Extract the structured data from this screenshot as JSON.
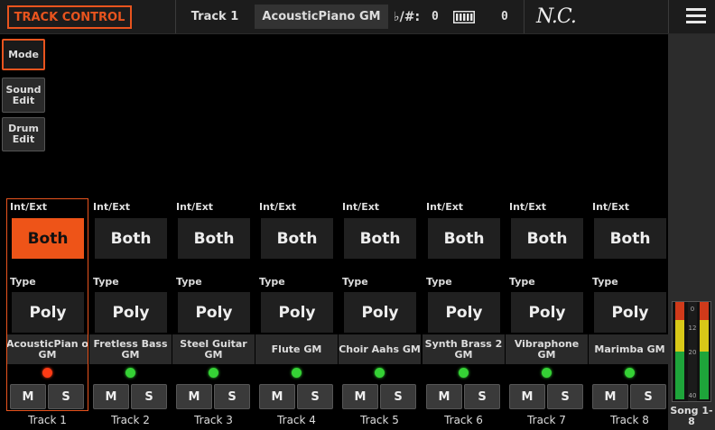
{
  "header": {
    "title": "TRACK CONTROL",
    "track": "Track 1",
    "sound": "AcousticPiano GM",
    "key_label": "♭/#:",
    "key_value": "0",
    "octave_value": "0",
    "chord": "N.C."
  },
  "sidebar": {
    "buttons": [
      {
        "label": "Mode",
        "active": true
      },
      {
        "label": "Sound Edit",
        "active": false
      },
      {
        "label": "Drum Edit",
        "active": false
      }
    ],
    "meter_scale": [
      "0",
      "12",
      "20",
      "40"
    ],
    "song_label": "Song 1-8"
  },
  "labels": {
    "int_ext": "Int/Ext",
    "type": "Type",
    "mute": "M",
    "solo": "S"
  },
  "tracks": [
    {
      "int_ext": "Both",
      "type": "Poly",
      "sound": "AcousticPian o GM",
      "name": "Track 1",
      "led": "red",
      "selected": true
    },
    {
      "int_ext": "Both",
      "type": "Poly",
      "sound": "Fretless Bass GM",
      "name": "Track 2",
      "led": "green",
      "selected": false
    },
    {
      "int_ext": "Both",
      "type": "Poly",
      "sound": "Steel Guitar GM",
      "name": "Track 3",
      "led": "green",
      "selected": false
    },
    {
      "int_ext": "Both",
      "type": "Poly",
      "sound": "Flute GM",
      "name": "Track 4",
      "led": "green",
      "selected": false
    },
    {
      "int_ext": "Both",
      "type": "Poly",
      "sound": "Choir Aahs GM",
      "name": "Track 5",
      "led": "green",
      "selected": false
    },
    {
      "int_ext": "Both",
      "type": "Poly",
      "sound": "Synth Brass 2 GM",
      "name": "Track 6",
      "led": "green",
      "selected": false
    },
    {
      "int_ext": "Both",
      "type": "Poly",
      "sound": "Vibraphone GM",
      "name": "Track 7",
      "led": "green",
      "selected": false
    },
    {
      "int_ext": "Both",
      "type": "Poly",
      "sound": "Marimba GM",
      "name": "Track 8",
      "led": "green",
      "selected": false
    }
  ],
  "colors": {
    "accent": "#e8541e",
    "led_green": "#35d235",
    "led_red": "#ff3b15"
  }
}
